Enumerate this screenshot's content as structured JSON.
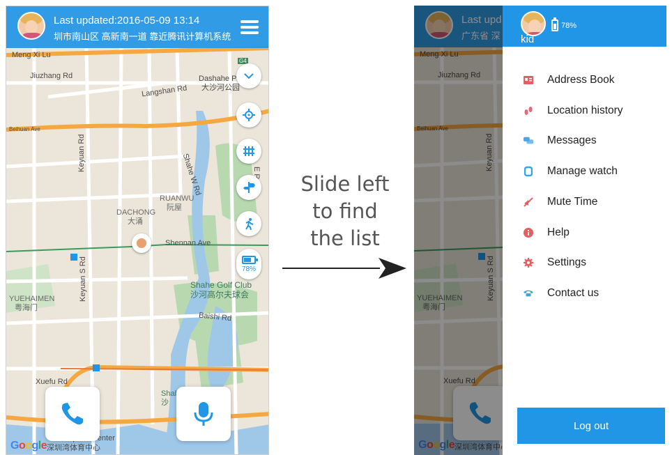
{
  "left_screen": {
    "header": {
      "title": "Last updated:2016-05-09 13:14",
      "address": "圳市南山区 高新南一道 靠近腾讯计算机系统"
    },
    "map_labels": {
      "meng_xi_lu": "Meng Xi Lu",
      "jiuzhang_rd": "Jiuzhang Rd",
      "langshan_rd": "Langshan Rd",
      "dashahe_en": "Dashahe P",
      "dashahe_cn": "大沙河公园",
      "beihuan_ave": "Beihuan Ave",
      "keyuan_rd": "Keyuan Rd",
      "shahe_w_rd": "Shahe W Rd",
      "shahe_e_rd": "E Rd",
      "ruanwu_en": "RUANWU",
      "ruanwu_cn": "阮屋",
      "dachong_en": "DACHONG",
      "dachong_cn": "大涌",
      "shennan_ave": "Shennan Ave",
      "keyuan_s_rd": "Keyuan S Rd",
      "yuehaimen_en": "YUEHAIMEN",
      "yuehaimen_cn": "粤海门",
      "shahe_golf_en": "Shahe Golf Club",
      "shahe_golf_cn": "沙河高尔夫球会",
      "baishi_rd": "Baishi Rd",
      "xuefu_rd": "Xuefu Rd",
      "sports_center_en": "Sports Center",
      "sports_center_cn": "深圳湾体育中心",
      "shah": "Shah",
      "sha_cn": "沙",
      "g4": "G4"
    },
    "battery_label": "78%",
    "google_letters": [
      "G",
      "o",
      "o",
      "g",
      "l",
      "e"
    ]
  },
  "instruction": {
    "line1": "Slide left",
    "line2": "to find",
    "line3": "the list"
  },
  "right_screen": {
    "header_fragment": "Last upd",
    "address_fragment": "广东省 深",
    "drawer": {
      "battery": "78%",
      "battery_fraction": 0.78,
      "name": "kid",
      "menu": [
        {
          "label": "Address Book",
          "icon": "address-book-icon",
          "color": "#e45f5f"
        },
        {
          "label": "Location history",
          "icon": "footprints-icon",
          "color": "#e8677a"
        },
        {
          "label": "Messages",
          "icon": "chat-bubbles-icon",
          "color": "#4aa6e8"
        },
        {
          "label": "Manage watch",
          "icon": "watch-icon",
          "color": "#35a6e6"
        },
        {
          "label": "Mute Time",
          "icon": "mute-icon",
          "color": "#e45f5f"
        },
        {
          "label": "Help",
          "icon": "info-icon",
          "color": "#e45f5f"
        },
        {
          "label": "Settings",
          "icon": "gear-icon",
          "color": "#e45f5f"
        },
        {
          "label": "Contact us",
          "icon": "phone-icon",
          "color": "#35a6e6"
        }
      ],
      "logout": "Log out"
    }
  },
  "colors": {
    "brand_blue": "#2196e6",
    "map_background": "#ece6da",
    "road_orange": "#f5a742",
    "water": "#9fc7e8",
    "park_green": "#b8d9b0"
  }
}
